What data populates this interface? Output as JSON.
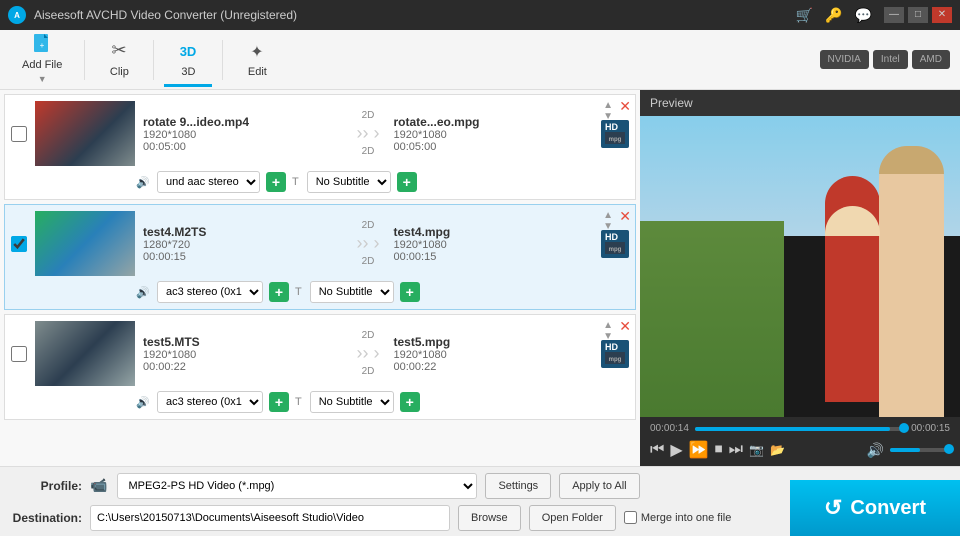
{
  "titlebar": {
    "logo": "A",
    "title": "Aiseesoft AVCHD Video Converter (Unregistered)",
    "controls": [
      "minimize",
      "maximize",
      "close"
    ]
  },
  "toolbar": {
    "buttons": [
      {
        "id": "add-file",
        "label": "Add File",
        "icon": "📄"
      },
      {
        "id": "clip",
        "label": "Clip",
        "icon": "✂️"
      },
      {
        "id": "3d",
        "label": "3D",
        "icon": "3D",
        "active": true
      },
      {
        "id": "edit",
        "label": "Edit",
        "icon": "✦"
      }
    ],
    "gpu_labels": [
      "NVIDIA",
      "Intel",
      "AMD"
    ]
  },
  "file_list": {
    "items": [
      {
        "id": 1,
        "selected": false,
        "thumb_class": "thumb-1",
        "input_name": "rotate 9...ideo.mp4",
        "input_dim": "1920*1080",
        "input_dur": "00:05:00",
        "mode_in": "2D",
        "mode_out": "2D",
        "output_name": "rotate...eo.mpg",
        "output_dim": "1920*1080",
        "output_dur": "00:05:00",
        "badge": "HD",
        "audio": "und aac stereo",
        "subtitle": "No Subtitle"
      },
      {
        "id": 2,
        "selected": true,
        "thumb_class": "thumb-2",
        "input_name": "test4.M2TS",
        "input_dim": "1280*720",
        "input_dur": "00:00:15",
        "mode_in": "2D",
        "mode_out": "2D",
        "output_name": "test4.mpg",
        "output_dim": "1920*1080",
        "output_dur": "00:00:15",
        "badge": "HD",
        "audio": "ac3 stereo (0x1",
        "subtitle": "No Subtitle"
      },
      {
        "id": 3,
        "selected": false,
        "thumb_class": "thumb-3",
        "input_name": "test5.MTS",
        "input_dim": "1920*1080",
        "input_dur": "00:00:22",
        "mode_in": "2D",
        "mode_out": "2D",
        "output_name": "test5.mpg",
        "output_dim": "1920*1080",
        "output_dur": "00:00:22",
        "badge": "HD",
        "audio": "ac3 stereo (0x1",
        "subtitle": "No Subtitle"
      }
    ]
  },
  "preview": {
    "label": "Preview",
    "time_current": "00:00:14",
    "time_total": "00:00:15",
    "progress_pct": 93
  },
  "playback_buttons": [
    "skip-back",
    "play",
    "fast-forward",
    "stop",
    "skip-end",
    "camera",
    "folder",
    "volume"
  ],
  "bottom": {
    "profile_label": "Profile:",
    "profile_value": "MPEG2-PS HD Video (*.mpg)",
    "settings_label": "Settings",
    "apply_all_label": "Apply to All",
    "dest_label": "Destination:",
    "dest_value": "C:\\Users\\20150713\\Documents\\Aiseesoft Studio\\Video",
    "browse_label": "Browse",
    "open_folder_label": "Open Folder",
    "merge_label": "Merge into one file",
    "convert_label": "Convert"
  }
}
